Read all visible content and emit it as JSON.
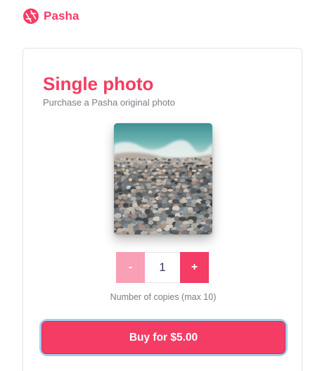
{
  "brand": {
    "name": "Pasha",
    "icon": "aperture-icon",
    "color": "#f43c64"
  },
  "product": {
    "title": "Single photo",
    "subtitle": "Purchase a Pasha original photo",
    "photo_alt": "Pebble beach with sea waves"
  },
  "quantity": {
    "decrement_label": "-",
    "increment_label": "+",
    "value": "1",
    "note": "Number of copies (max 10)"
  },
  "checkout": {
    "buy_label": "Buy for $5.00"
  },
  "colors": {
    "accent": "#f43c64",
    "accent_light": "#f9a0b4",
    "focus_ring": "#a9cdea"
  }
}
